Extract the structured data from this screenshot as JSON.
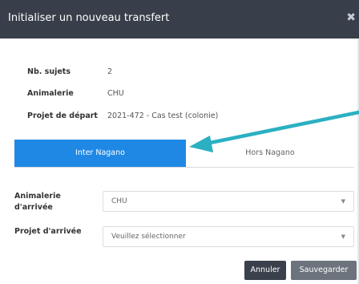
{
  "modal": {
    "title": "Initialiser un nouveau transfert",
    "close_icon": "close-icon"
  },
  "info": [
    {
      "label": "Nb. sujets",
      "value": "2"
    },
    {
      "label": "Animalerie",
      "value": "CHU"
    },
    {
      "label": "Projet de départ",
      "value": "2021-472 - Cas test (colonie)"
    }
  ],
  "tabs": [
    {
      "label": "Inter Nagano",
      "active": true
    },
    {
      "label": "Hors Nagano",
      "active": false
    }
  ],
  "form": {
    "animalerie_arrivee": {
      "label": "Animalerie d'arrivée",
      "value": "CHU"
    },
    "projet_arrivee": {
      "label": "Projet d'arrivée",
      "placeholder": "Veuillez sélectionner"
    }
  },
  "buttons": {
    "cancel": "Annuler",
    "save": "Sauvegarder"
  },
  "colors": {
    "header": "#383f4a",
    "tab_active": "#1f88e5",
    "annotation_arrow": "#2bb0c2",
    "button_cancel": "#3a414c",
    "button_save": "#6c737d"
  }
}
